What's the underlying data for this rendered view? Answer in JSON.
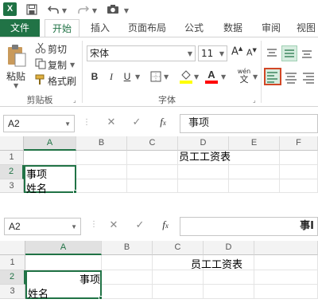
{
  "qat": {
    "logo": "X",
    "icons": [
      "excel-logo-icon",
      "save-icon",
      "undo-icon",
      "redo-icon",
      "camera-icon"
    ]
  },
  "tabs": {
    "file": "文件",
    "items": [
      "开始",
      "插入",
      "页面布局",
      "公式",
      "数据",
      "审阅",
      "视图"
    ]
  },
  "ribbon": {
    "clipboard": {
      "paste": "粘贴",
      "cut": "剪切",
      "copy": "复制",
      "format_painter": "格式刷",
      "label": "剪贴板"
    },
    "font": {
      "name": "宋体",
      "size": "11",
      "bold": "B",
      "italic": "I",
      "underline": "U",
      "grow": "A",
      "shrink": "A",
      "font_color": "A",
      "wen": "wén",
      "wen_char": "文",
      "label": "字体"
    },
    "colors": {
      "accent": "#217346",
      "fill_yellow": "#ffff00",
      "font_red": "#ff0000"
    }
  },
  "sheet1": {
    "namebox": "A2",
    "formula": "事项",
    "columns": [
      "A",
      "B",
      "C",
      "D",
      "E",
      "F"
    ],
    "rows": [
      "1",
      "2",
      "3"
    ],
    "title": "员工工资表",
    "a2": "事项",
    "a3": "姓名"
  },
  "sheet2": {
    "namebox": "A2",
    "formula": "事I",
    "columns": [
      "A",
      "B",
      "C",
      "D"
    ],
    "rows": [
      "1",
      "2",
      "3"
    ],
    "title": "员工工资表",
    "a2": "事项",
    "a3": "姓名"
  }
}
